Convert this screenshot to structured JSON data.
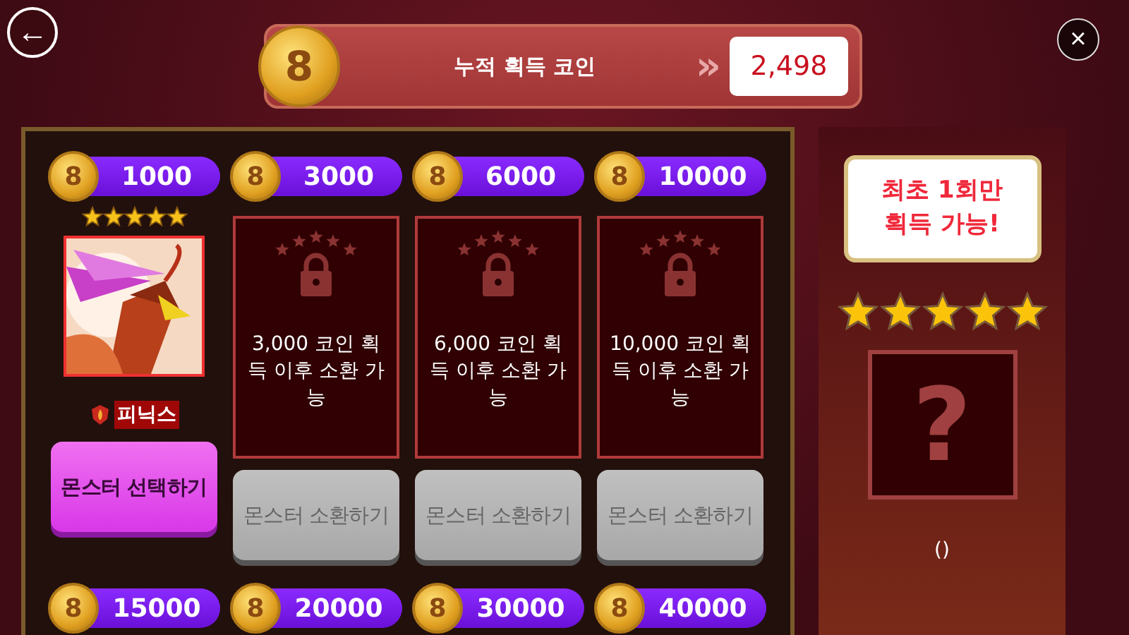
{
  "header": {
    "back_button": "←",
    "close_button": "×",
    "coin_mark": "8",
    "title": "누적 획득 코인",
    "chevrons": "»",
    "total": "2,498"
  },
  "tiers": [
    {
      "kind": "monster",
      "coin_mark": "8",
      "price": "1000",
      "stars": 5,
      "name": "피닉스",
      "button": {
        "label": "몬스터 선택하기",
        "enabled": true
      }
    },
    {
      "kind": "locked",
      "coin_mark": "8",
      "price": "3000",
      "message": "3,000 코인 획득 이후 소환 가능",
      "button": {
        "label": "몬스터 소환하기",
        "enabled": false
      }
    },
    {
      "kind": "locked",
      "coin_mark": "8",
      "price": "6000",
      "message": "6,000 코인 획득 이후 소환 가능",
      "button": {
        "label": "몬스터 소환하기",
        "enabled": false
      }
    },
    {
      "kind": "locked",
      "coin_mark": "8",
      "price": "10000",
      "message": "10,000 코인 획득 이후 소환 가능",
      "button": {
        "label": "몬스터 소환하기",
        "enabled": false
      }
    },
    {
      "kind": "price_only",
      "coin_mark": "8",
      "price": "15000"
    },
    {
      "kind": "price_only",
      "coin_mark": "8",
      "price": "20000"
    },
    {
      "kind": "price_only",
      "coin_mark": "8",
      "price": "30000"
    },
    {
      "kind": "price_only",
      "coin_mark": "8",
      "price": "40000"
    }
  ],
  "reward": {
    "bubble": "최초 1회만 획득 가능!",
    "stars": 5,
    "mystery": "?",
    "caption": "()"
  }
}
